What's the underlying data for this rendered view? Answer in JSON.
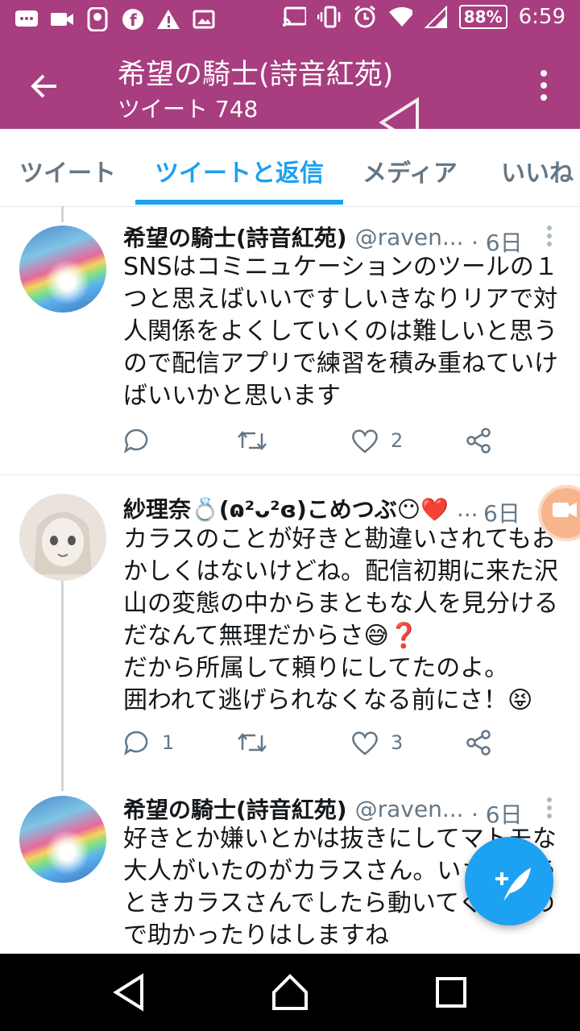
{
  "status_bar": {
    "battery": "88%",
    "time": "6:59"
  },
  "header": {
    "title": "希望の騎士(詩音紅苑)",
    "subtitle": "ツイート 748"
  },
  "tabs": [
    {
      "label": "ツイート"
    },
    {
      "label": "ツイートと返信"
    },
    {
      "label": "メディア"
    },
    {
      "label": "いいね"
    }
  ],
  "tweets": [
    {
      "name": "希望の騎士(詩音紅苑)",
      "handle": "@raven...",
      "time": "· 6日",
      "lines": [
        "SNSはコミニュケーションのツールの１",
        "つと思えばいいですしいきなりリアで対",
        "人関係をよくしていくのは難しいと思う",
        "ので配信アプリで練習を積み重ねていけ",
        "ばいいかと思います"
      ],
      "replies": "",
      "likes": "2"
    },
    {
      "name": "紗理奈💍(ɷ²ᴗ²ɞ)こめつぶ😶❤️",
      "handle": "...",
      "time": "6日",
      "lines": [
        "カラスのことが好きと勘違いされてもお",
        "かしくはないけどね。配信初期に来た沢",
        "山の変態の中からまともな人を見分ける",
        "だなんて無理だからさ😅❓",
        "だから所属して頼りにしてたのよ。",
        "囲われて逃げられなくなる前にさ！😝"
      ],
      "replies": "1",
      "likes": "3"
    },
    {
      "name": "希望の騎士(詩音紅苑)",
      "handle": "@raven...",
      "time": "· 6日",
      "lines": [
        "好きとか嫌いとかは抜きにしてマトモな",
        "大人がいたのがカラスさん。いざという",
        "ときカラスさんでしたら動いてくれるの",
        "で助かったりはしますね"
      ]
    }
  ]
}
